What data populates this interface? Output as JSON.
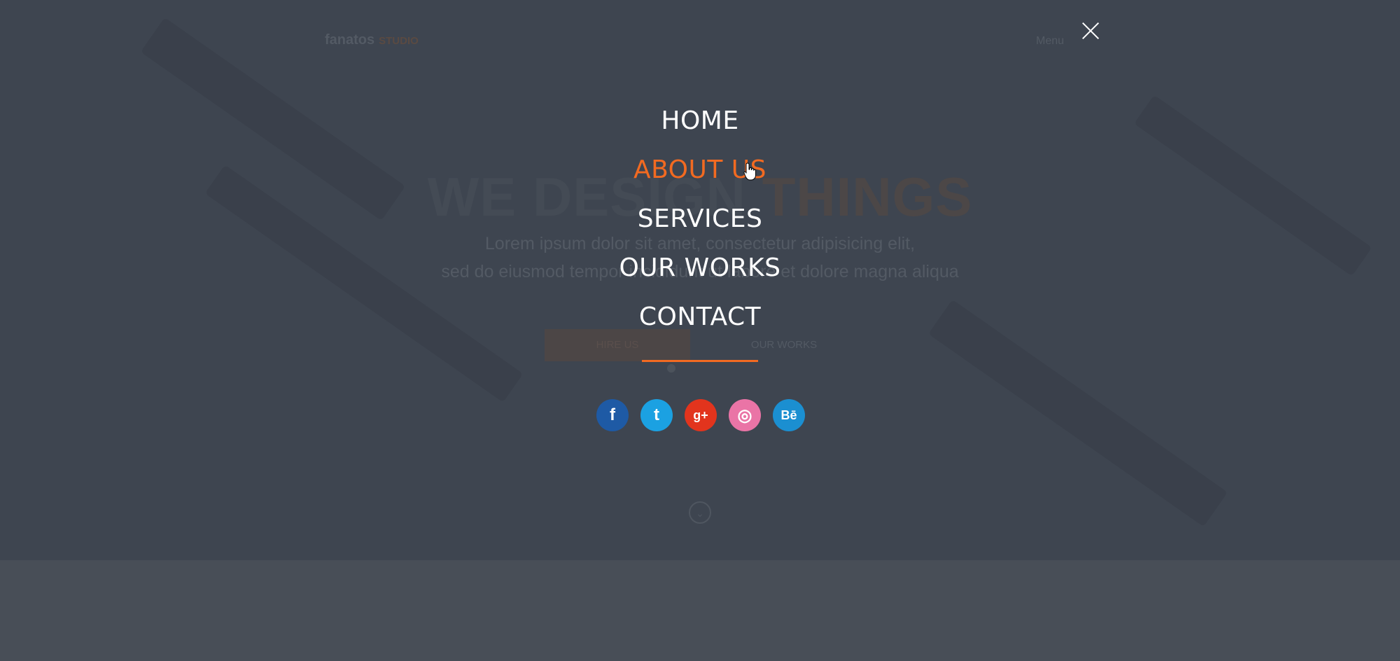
{
  "background": {
    "logo": {
      "name": "fanatos",
      "accent": "STUDIO"
    },
    "menu_label": "Menu",
    "headline": {
      "part1": "WE DESIGN ",
      "part2": "THINGS"
    },
    "subline_1": "Lorem ipsum dolor sit amet, consectetur adipisicing elit,",
    "subline_2": "sed do eiusmod tempor incididunt ut labore et dolore magna aliqua",
    "buttons": {
      "primary": "HIRE US",
      "secondary": "OUR WORKS"
    }
  },
  "overlay": {
    "nav_items": [
      {
        "label": "HOME",
        "active": false
      },
      {
        "label": "ABOUT US",
        "active": true
      },
      {
        "label": "SERVICES",
        "active": false
      },
      {
        "label": "OUR WORKS",
        "active": false
      },
      {
        "label": "CONTACT",
        "active": false
      }
    ],
    "social": [
      {
        "icon": "facebook-icon",
        "glyph": "f",
        "color": "#1e5aa5"
      },
      {
        "icon": "twitter-icon",
        "glyph": "t",
        "color": "#1ba1e2"
      },
      {
        "icon": "google-plus-icon",
        "glyph": "g+",
        "color": "#e2341d"
      },
      {
        "icon": "dribbble-icon",
        "glyph": "◎",
        "color": "#ea74a6"
      },
      {
        "icon": "behance-icon",
        "glyph": "Bē",
        "color": "#1b8fd1"
      }
    ],
    "colors": {
      "accent": "#f26a21",
      "overlay": "#3e4550"
    }
  }
}
